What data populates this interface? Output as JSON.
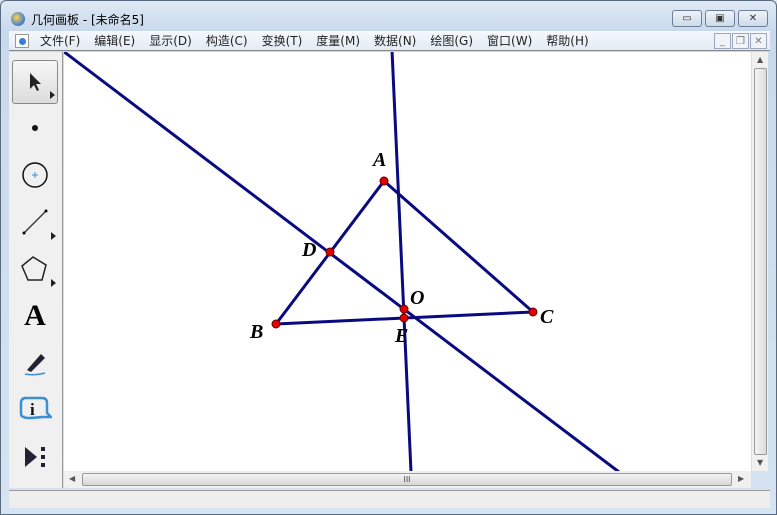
{
  "window": {
    "title": "几何画板 - [未命名5]"
  },
  "menu": [
    "文件(F)",
    "编辑(E)",
    "显示(D)",
    "构造(C)",
    "变换(T)",
    "度量(M)",
    "数据(N)",
    "绘图(G)",
    "窗口(W)",
    "帮助(H)"
  ],
  "tools": [
    "arrow-select-tool",
    "point-tool",
    "compass-tool",
    "straightedge-tool",
    "polygon-tool",
    "text-tool",
    "marker-tool",
    "information-tool",
    "custom-tool"
  ],
  "text_tool_glyph": "A",
  "info_tool_glyph": "i",
  "figure": {
    "line_color": "#0a0a80",
    "point_color": "#e00000",
    "points": {
      "A": "A",
      "B": "B",
      "C": "C",
      "D": "D",
      "O": "O",
      "E": "E"
    }
  },
  "hscroll_grip": "III"
}
